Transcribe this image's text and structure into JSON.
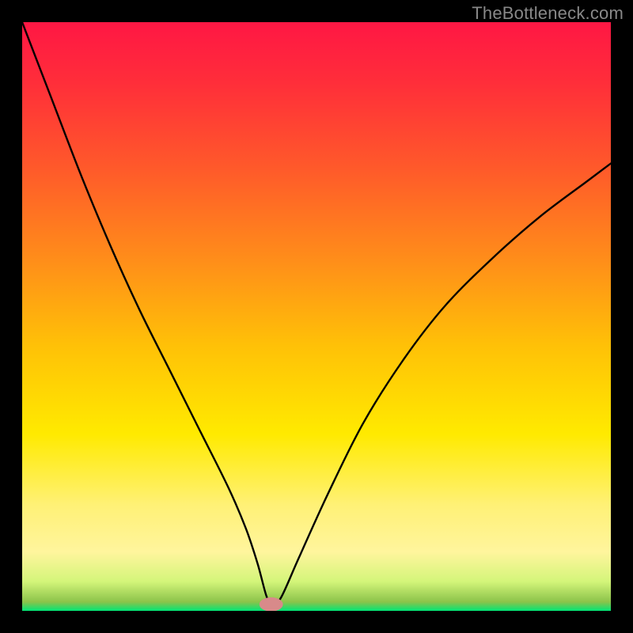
{
  "watermark": "TheBottleneck.com",
  "chart_data": {
    "type": "line",
    "title": "",
    "xlabel": "",
    "ylabel": "",
    "xlim": [
      0,
      100
    ],
    "ylim": [
      0,
      100
    ],
    "background_gradient": {
      "stops": [
        {
          "offset": 0.0,
          "color": "#ff1744"
        },
        {
          "offset": 0.1,
          "color": "#ff2d3a"
        },
        {
          "offset": 0.25,
          "color": "#ff5a2a"
        },
        {
          "offset": 0.4,
          "color": "#ff8c1a"
        },
        {
          "offset": 0.55,
          "color": "#ffc107"
        },
        {
          "offset": 0.7,
          "color": "#ffea00"
        },
        {
          "offset": 0.82,
          "color": "#fff176"
        },
        {
          "offset": 0.9,
          "color": "#fff59d"
        },
        {
          "offset": 0.95,
          "color": "#d4f57a"
        },
        {
          "offset": 0.985,
          "color": "#8bc34a"
        },
        {
          "offset": 1.0,
          "color": "#00e676"
        }
      ]
    },
    "series": [
      {
        "name": "bottleneck-curve",
        "color": "#000000",
        "x": [
          0,
          5,
          10,
          15,
          20,
          25,
          30,
          35,
          38,
          40,
          41.5,
          42.5,
          44,
          47,
          52,
          58,
          65,
          72,
          80,
          88,
          96,
          100
        ],
        "y": [
          100,
          87,
          74,
          62,
          51,
          41,
          31,
          21,
          14,
          8,
          2.5,
          1,
          2.3,
          9,
          20,
          32,
          43,
          52,
          60,
          67,
          73,
          76
        ]
      }
    ],
    "marker": {
      "name": "min-point",
      "x": 42.3,
      "y": 1.1,
      "color": "#d88a8a",
      "rx": 2.0,
      "ry": 1.2
    }
  }
}
